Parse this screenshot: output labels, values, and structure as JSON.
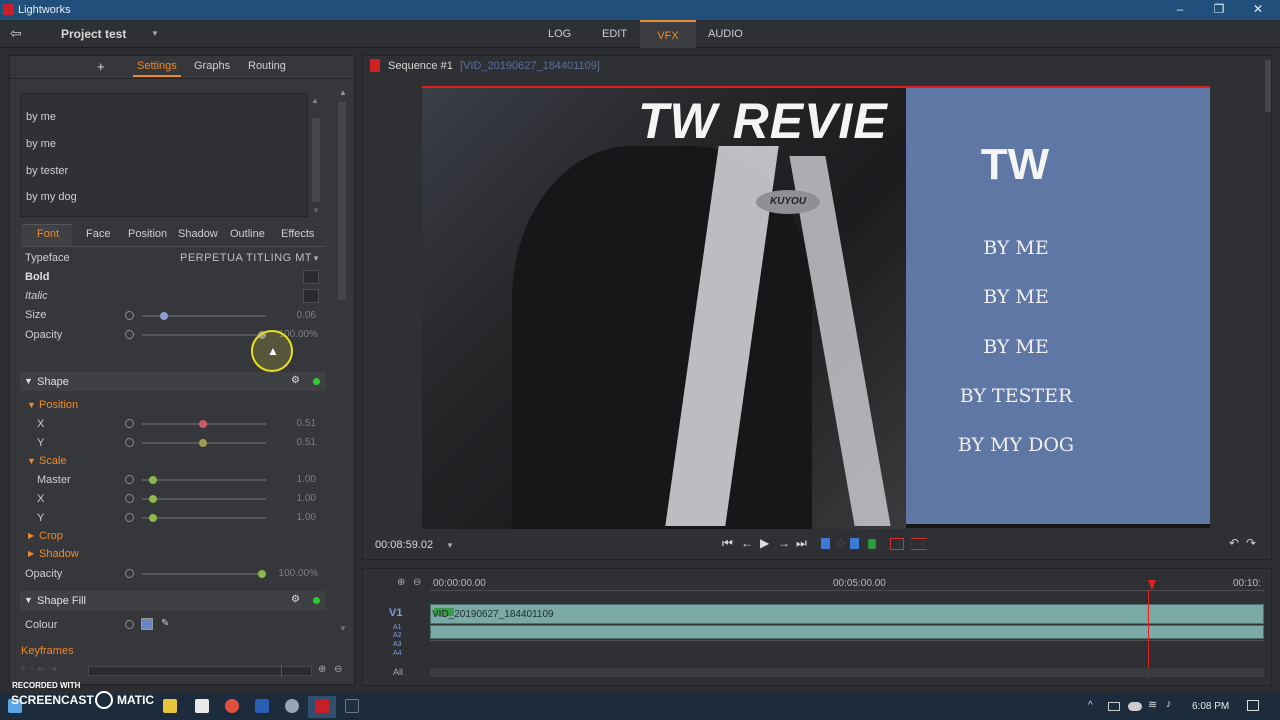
{
  "window": {
    "title": "Lightworks",
    "minimize": "–",
    "maximize": "❐",
    "close": "✕"
  },
  "topbar": {
    "exit_icon": "⇦",
    "project": "Project test",
    "project_caret": "▼",
    "menus": [
      "LOG",
      "EDIT",
      "VFX",
      "AUDIO"
    ],
    "active_menu": "VFX"
  },
  "left": {
    "tabs": {
      "add": "+",
      "settings": "Settings",
      "graphs": "Graphs",
      "routing": "Routing"
    },
    "list": [
      "by me",
      "by me",
      "by tester",
      "by my dog"
    ],
    "subtabs": [
      "Font",
      "Face",
      "Position",
      "Shadow",
      "Outline",
      "Effects"
    ],
    "font": {
      "typeface_label": "Typeface",
      "typeface_value": "PERPETUA TITLING MT",
      "bold": "Bold",
      "italic": "Italic",
      "size_label": "Size",
      "size_value": "0.06",
      "size_level": 0.18,
      "opacity_label": "Opacity",
      "opacity_value": "100.00%",
      "opacity_level": 1.0
    },
    "shape": {
      "header": "Shape",
      "position": "Position",
      "x_label": "X",
      "x_value": "0.51",
      "y_label": "Y",
      "y_value": "0.51",
      "scale": "Scale",
      "master_label": "Master",
      "master_value": "1.00",
      "sx_label": "X",
      "sx_value": "1.00",
      "sy_label": "Y",
      "sy_value": "1.00",
      "crop": "Crop",
      "shadow": "Shadow",
      "opacity_label": "Opacity",
      "opacity_value": "100.00%"
    },
    "shapefill": {
      "header": "Shape Fill",
      "colour_label": "Colour",
      "colour": "#6b86c4"
    },
    "keyframes": "Keyframes"
  },
  "viewer": {
    "sequence": "Sequence #1",
    "clip": "[VID_20190627_184401109]",
    "timecode": "00:08:59.02",
    "caret": "▼",
    "video_title": "TW REVIE",
    "brand": "KUYOU",
    "panel": {
      "title": "TW",
      "lines": [
        "BY ME",
        "BY ME",
        "BY ME",
        "BY TESTER",
        "BY MY DOG"
      ]
    }
  },
  "timeline": {
    "t0": "00:00:00.00",
    "t1": "00:05:00.00",
    "t2": "00:10:",
    "track": "V1",
    "audio": [
      "A1",
      "A2",
      "A3",
      "A4"
    ],
    "clip": "VID_20190627_184401109",
    "all": "All"
  },
  "watermark": {
    "line1": "RECORDED WITH",
    "line2": "SCREENCAST",
    "line3": "MATIC"
  },
  "taskbar": {
    "time": "6:08 PM"
  },
  "colors": {
    "accent": "#ee8a2a",
    "bluepanel": "#5f77a5",
    "clip": "#7aa9a6",
    "playhead": "#e02020"
  }
}
